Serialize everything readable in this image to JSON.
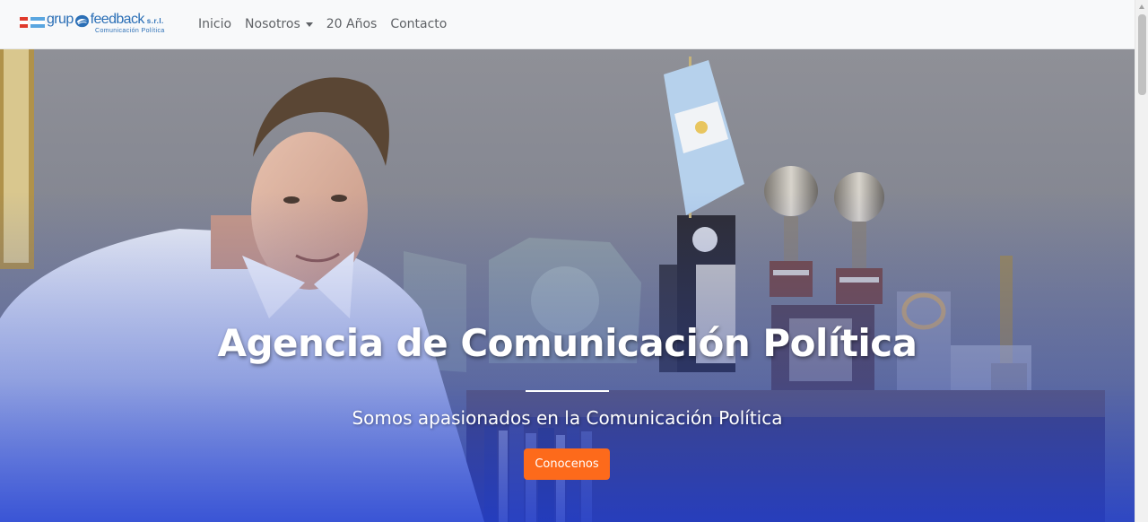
{
  "brand": {
    "name_part1": "grup",
    "name_part2": "feedback",
    "suffix": "s.r.l.",
    "tagline": "Comunicación Política",
    "color": "#2b6fb6"
  },
  "nav": {
    "items": [
      {
        "label": "Inicio"
      },
      {
        "label": "Nosotros"
      },
      {
        "label": "20 Años"
      },
      {
        "label": "Contacto"
      }
    ]
  },
  "hero": {
    "title": "Agencia de Comunicación Política",
    "subtitle": "Somos apasionados en la Comunicación Política",
    "button_label": "Conocenos",
    "button_color": "#fd6a1b"
  },
  "icons": {
    "brand_flag": "argentina-flag-icon",
    "brand_swirl": "swirl-logo-icon",
    "dropdown": "caret-down-icon"
  }
}
